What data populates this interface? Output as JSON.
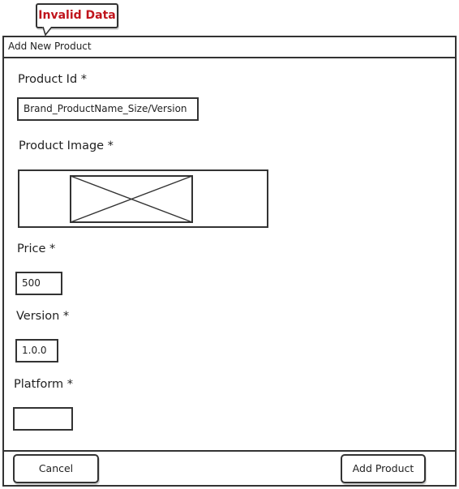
{
  "error_tooltip": {
    "text": "Invalid Data",
    "color": "#c0141c"
  },
  "dialog": {
    "title": "Add New Product"
  },
  "fields": {
    "product_id": {
      "label": "Product Id *",
      "value": "Brand_ProductName_Size/Version"
    },
    "product_image": {
      "label": "Product Image *",
      "icon": "image-placeholder-icon"
    },
    "price": {
      "label": "Price *",
      "value": "500"
    },
    "version": {
      "label": "Version *",
      "value": "1.0.0"
    },
    "platform": {
      "label": "Platform *",
      "value": ""
    }
  },
  "buttons": {
    "cancel": "Cancel",
    "add_product": "Add Product"
  }
}
